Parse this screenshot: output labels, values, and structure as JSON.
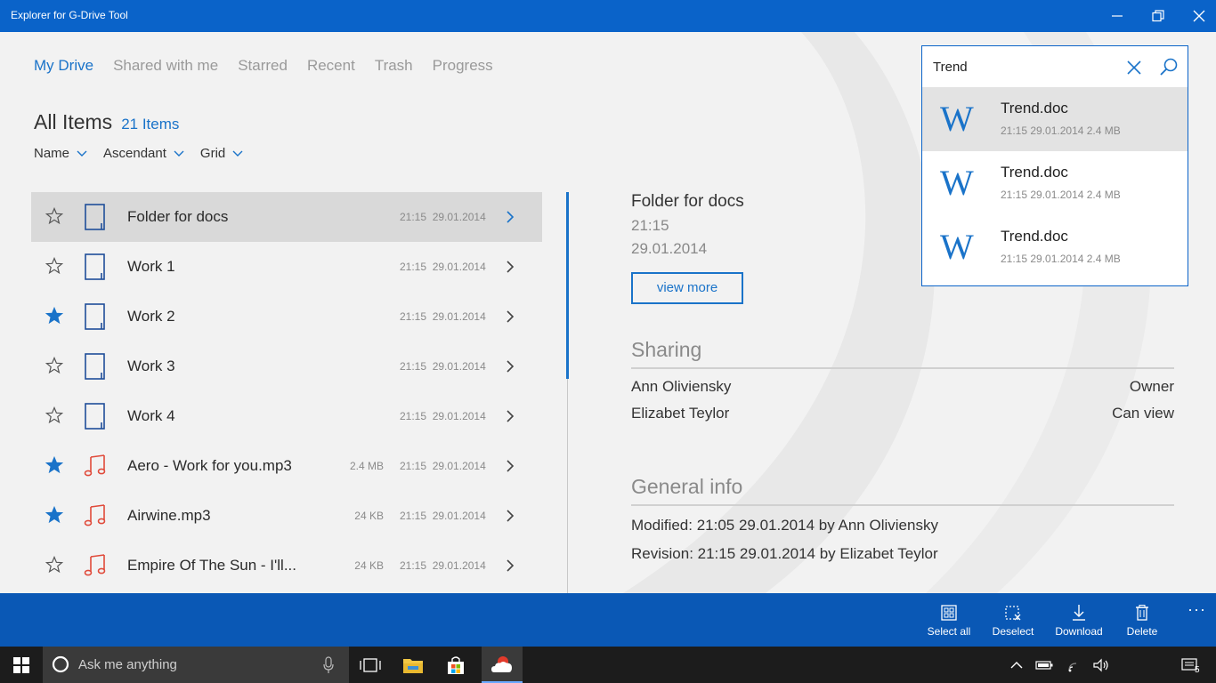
{
  "window": {
    "title": "Explorer for G-Drive Tool"
  },
  "tabs": [
    {
      "label": "My Drive",
      "active": true
    },
    {
      "label": "Shared with me",
      "active": false
    },
    {
      "label": "Starred",
      "active": false
    },
    {
      "label": "Recent",
      "active": false
    },
    {
      "label": "Trash",
      "active": false
    },
    {
      "label": "Progress",
      "active": false
    }
  ],
  "items_header": {
    "heading": "All Items",
    "count": "21 Items"
  },
  "sort": {
    "field": "Name",
    "order": "Ascendant",
    "view": "Grid"
  },
  "files": [
    {
      "name": "Folder for docs",
      "type": "document-icon",
      "size": "",
      "time": "21:15",
      "date": "29.01.2014",
      "starred": false,
      "selected": true
    },
    {
      "name": "Work 1",
      "type": "document-icon",
      "size": "",
      "time": "21:15",
      "date": "29.01.2014",
      "starred": false,
      "selected": false
    },
    {
      "name": "Work 2",
      "type": "document-icon",
      "size": "",
      "time": "21:15",
      "date": "29.01.2014",
      "starred": true,
      "selected": false
    },
    {
      "name": "Work 3",
      "type": "document-icon",
      "size": "",
      "time": "21:15",
      "date": "29.01.2014",
      "starred": false,
      "selected": false
    },
    {
      "name": "Work 4",
      "type": "document-icon",
      "size": "",
      "time": "21:15",
      "date": "29.01.2014",
      "starred": false,
      "selected": false
    },
    {
      "name": "Aero - Work  for you.mp3",
      "type": "music-icon",
      "size": "2.4 MB",
      "time": "21:15",
      "date": "29.01.2014",
      "starred": true,
      "selected": false
    },
    {
      "name": "Airwine.mp3",
      "type": "music-icon",
      "size": "24 KB",
      "time": "21:15",
      "date": "29.01.2014",
      "starred": true,
      "selected": false
    },
    {
      "name": "Empire Of The Sun - I'll...",
      "type": "music-icon",
      "size": "24 KB",
      "time": "21:15",
      "date": "29.01.2014",
      "starred": false,
      "selected": false
    }
  ],
  "details": {
    "title": "Folder for docs",
    "time": "21:15",
    "date": "29.01.2014",
    "view_more_label": "view more",
    "sharing_heading": "Sharing",
    "sharing": [
      {
        "person": "Ann Oliviensky",
        "role": "Owner"
      },
      {
        "person": "Elizabet Teylor",
        "role": "Can view"
      }
    ],
    "general_heading": "General info",
    "modified": "Modified: 21:05   29.01.2014 by Ann Oliviensky",
    "revision": "Revision: 21:15   29.01.2014 by Elizabet Teylor"
  },
  "search": {
    "query": "Trend",
    "results": [
      {
        "icon": "W",
        "name": "Trend.doc",
        "meta": "21:15  29.01.2014 2.4 MB",
        "highlighted": true
      },
      {
        "icon": "W",
        "name": "Trend.doc",
        "meta": "21:15  29.01.2014 2.4 MB",
        "highlighted": false
      },
      {
        "icon": "W",
        "name": "Trend.doc",
        "meta": "21:15  29.01.2014 2.4 MB",
        "highlighted": false
      }
    ]
  },
  "commands": {
    "select_all": "Select all",
    "deselect": "Deselect",
    "download": "Download",
    "delete": "Delete",
    "more": "···"
  },
  "taskbar": {
    "search_placeholder": "Ask me anything",
    "notification_count": "5"
  },
  "colors": {
    "accent": "#1a73c9",
    "titlebar": "#0a63c9",
    "commandbar": "#0a58b5",
    "star_on": "#1a73c9",
    "music": "#e04a3a"
  }
}
